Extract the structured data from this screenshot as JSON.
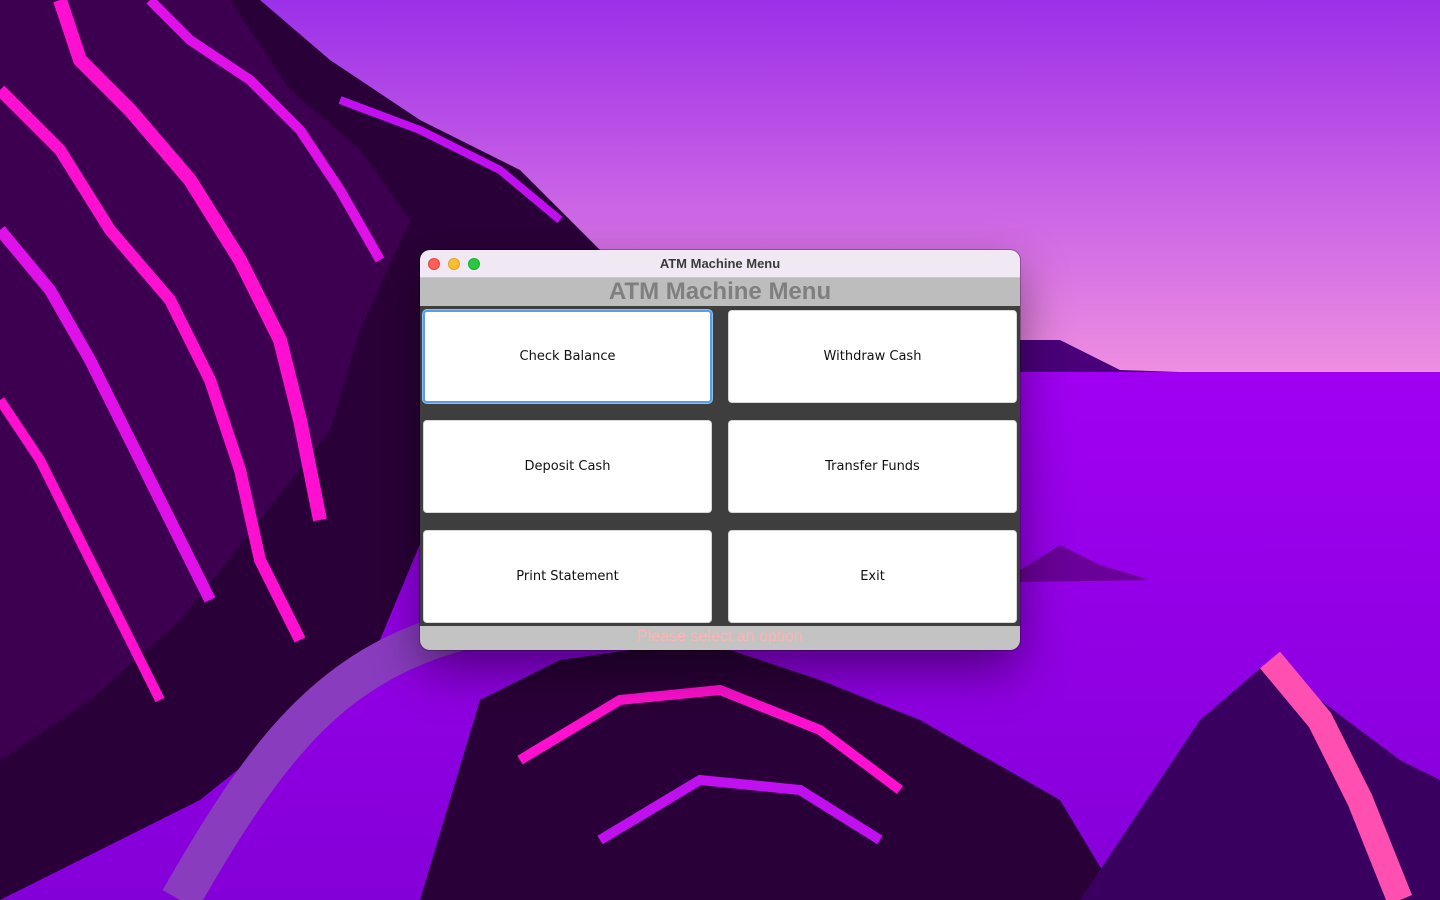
{
  "window": {
    "title": "ATM Machine Menu"
  },
  "header": {
    "title": "ATM Machine Menu"
  },
  "menu": {
    "buttons": [
      {
        "label": "Check Balance"
      },
      {
        "label": "Withdraw Cash"
      },
      {
        "label": "Deposit Cash"
      },
      {
        "label": "Transfer Funds"
      },
      {
        "label": "Print Statement"
      },
      {
        "label": "Exit"
      }
    ]
  },
  "status": {
    "message": "Please select an option"
  },
  "colors": {
    "header_bg": "#bdbdbd",
    "header_text": "#7f7f7f",
    "grid_bg": "#3e3e3e",
    "button_bg": "#ffffff",
    "focus_ring": "#5a9ee6",
    "status_text": "#ffb3b3"
  }
}
